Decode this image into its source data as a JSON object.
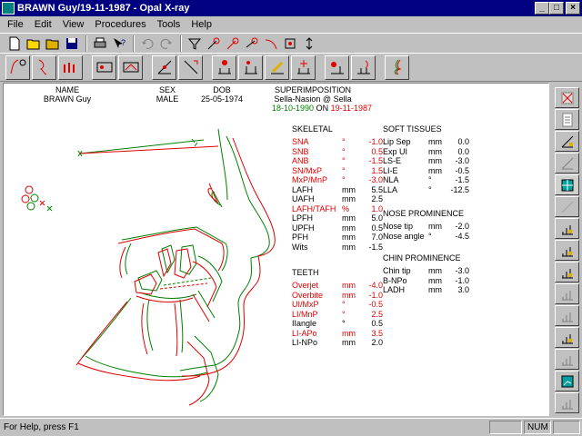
{
  "window": {
    "title": "BRAWN Guy/19-11-1987 - Opal X-ray"
  },
  "menu": [
    "File",
    "Edit",
    "View",
    "Procedures",
    "Tools",
    "Help"
  ],
  "patient": {
    "name_label": "NAME",
    "name": "BRAWN Guy",
    "sex_label": "SEX",
    "sex": "MALE",
    "dob_label": "DOB",
    "dob": "25-05-1974",
    "superimposition_label": "SUPERIMPOSITION",
    "superimposition": "Sella-Nasion @ Sella",
    "date_a": "18-10-1990",
    "on_word": "ON",
    "date_b": "19-11-1987"
  },
  "skeletal": {
    "title": "SKELETAL",
    "rows": [
      {
        "label": "SNA",
        "unit": "°",
        "value": "-1.0",
        "color": "#e00000"
      },
      {
        "label": "SNB",
        "unit": "°",
        "value": "0.5",
        "color": "#e00000"
      },
      {
        "label": "ANB",
        "unit": "°",
        "value": "-1.5",
        "color": "#e00000"
      },
      {
        "label": "SN/MxP",
        "unit": "°",
        "value": "1.5",
        "color": "#e00000"
      },
      {
        "label": "MxP/MnP",
        "unit": "°",
        "value": "-3.0",
        "color": "#e00000"
      },
      {
        "label": "LAFH",
        "unit": "mm",
        "value": "5.5",
        "color": "#000000"
      },
      {
        "label": "UAFH",
        "unit": "mm",
        "value": "2.5",
        "color": "#000000"
      },
      {
        "label": "LAFH/TAFH",
        "unit": "%",
        "value": "1.0",
        "color": "#e00000"
      },
      {
        "label": "LPFH",
        "unit": "mm",
        "value": "5.0",
        "color": "#000000"
      },
      {
        "label": "UPFH",
        "unit": "mm",
        "value": "0.5",
        "color": "#000000"
      },
      {
        "label": "PFH",
        "unit": "mm",
        "value": "7.0",
        "color": "#000000"
      },
      {
        "label": "Wits",
        "unit": "mm",
        "value": "-1.5",
        "color": "#000000"
      }
    ]
  },
  "teeth": {
    "title": "TEETH",
    "rows": [
      {
        "label": "Overjet",
        "unit": "mm",
        "value": "-4.0",
        "color": "#e00000"
      },
      {
        "label": "Overbite",
        "unit": "mm",
        "value": "-1.0",
        "color": "#e00000"
      },
      {
        "label": "UI/MxP",
        "unit": "°",
        "value": "-0.5",
        "color": "#e00000"
      },
      {
        "label": "LI/MnP",
        "unit": "°",
        "value": "2.5",
        "color": "#e00000"
      },
      {
        "label": "IIangle",
        "unit": "°",
        "value": "0.5",
        "color": "#000000"
      },
      {
        "label": "LI-APo",
        "unit": "mm",
        "value": "3.5",
        "color": "#e00000"
      },
      {
        "label": "LI-NPo",
        "unit": "mm",
        "value": "2.0",
        "color": "#000000"
      }
    ]
  },
  "soft_tissues": {
    "title": "SOFT TISSUES",
    "rows": [
      {
        "label": "Lip Sep",
        "unit": "mm",
        "value": "0.0"
      },
      {
        "label": "Exp UI",
        "unit": "mm",
        "value": "0.0"
      },
      {
        "label": "LS-E",
        "unit": "mm",
        "value": "-3.0"
      },
      {
        "label": "LI-E",
        "unit": "mm",
        "value": "-0.5"
      },
      {
        "label": "NLA",
        "unit": "°",
        "value": "-1.5"
      },
      {
        "label": "LLA",
        "unit": "°",
        "value": "-12.5"
      }
    ]
  },
  "nose": {
    "title": "NOSE PROMINENCE",
    "rows": [
      {
        "label": "Nose tip",
        "unit": "mm",
        "value": "-2.0"
      },
      {
        "label": "Nose angle",
        "unit": "°",
        "value": "-4.5"
      }
    ]
  },
  "chin": {
    "title": "CHIN PROMINENCE",
    "rows": [
      {
        "label": "Chin tip",
        "unit": "mm",
        "value": "-3.0"
      },
      {
        "label": "B-NPo",
        "unit": "mm",
        "value": "-1.0"
      },
      {
        "label": "LADH",
        "unit": "mm",
        "value": "3.0"
      }
    ]
  },
  "colors": {
    "tracing_a": "#008000",
    "tracing_b": "#e00000",
    "titlebar": "#000080"
  },
  "status": {
    "text": "For Help, press F1",
    "num": "NUM"
  }
}
